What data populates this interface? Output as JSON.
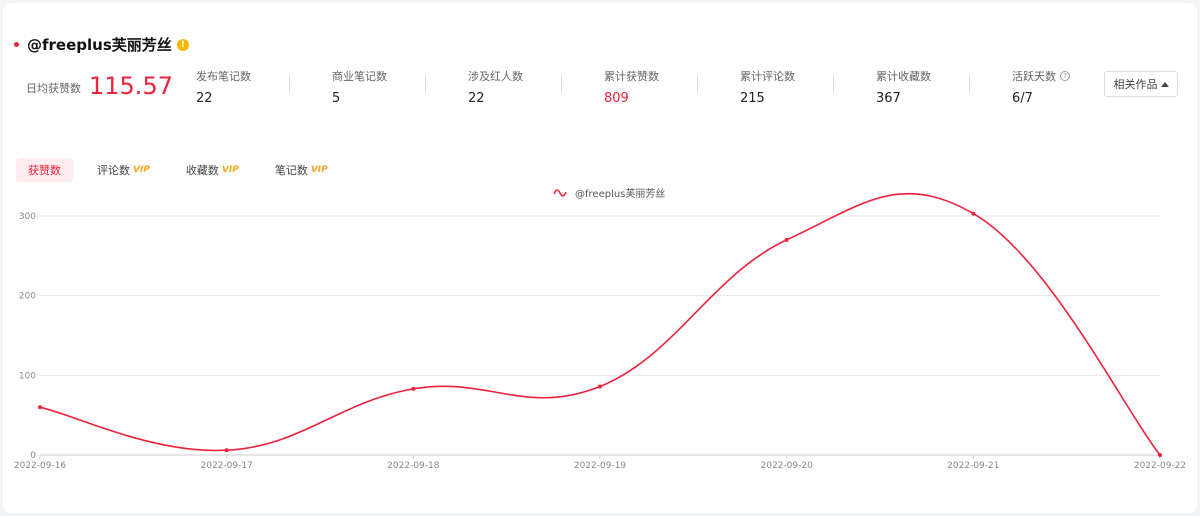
{
  "header": {
    "name": "@freeplus芙丽芳丝",
    "info_icon": "info-icon"
  },
  "avg": {
    "label": "日均获赞数",
    "value": "115.57"
  },
  "stats": [
    {
      "label": "发布笔记数",
      "value": "22"
    },
    {
      "label": "商业笔记数",
      "value": "5"
    },
    {
      "label": "涉及红人数",
      "value": "22"
    },
    {
      "label": "累计获赞数",
      "value": "809",
      "highlight": true
    },
    {
      "label": "累计评论数",
      "value": "215"
    },
    {
      "label": "累计收藏数",
      "value": "367"
    },
    {
      "label": "活跃天数",
      "value": "6/7",
      "help": "?"
    }
  ],
  "related_button": {
    "label": "相关作品"
  },
  "tabs": [
    {
      "label": "获赞数",
      "active": true
    },
    {
      "label": "评论数",
      "vip": "VIP"
    },
    {
      "label": "收藏数",
      "vip": "VIP"
    },
    {
      "label": "笔记数",
      "vip": "VIP"
    }
  ],
  "accent_color": "#f0213c",
  "chart_data": {
    "type": "line",
    "x": [
      "2022-09-16",
      "2022-09-17",
      "2022-09-18",
      "2022-09-19",
      "2022-09-20",
      "2022-09-21",
      "2022-09-22"
    ],
    "series": [
      {
        "name": "@freeplus芙丽芳丝",
        "values": [
          60,
          6,
          83,
          86,
          270,
          303,
          0
        ]
      }
    ],
    "yticks": [
      0,
      100,
      200,
      300
    ],
    "ylim": [
      0,
      300
    ],
    "grid": true,
    "legend": "top-center"
  }
}
